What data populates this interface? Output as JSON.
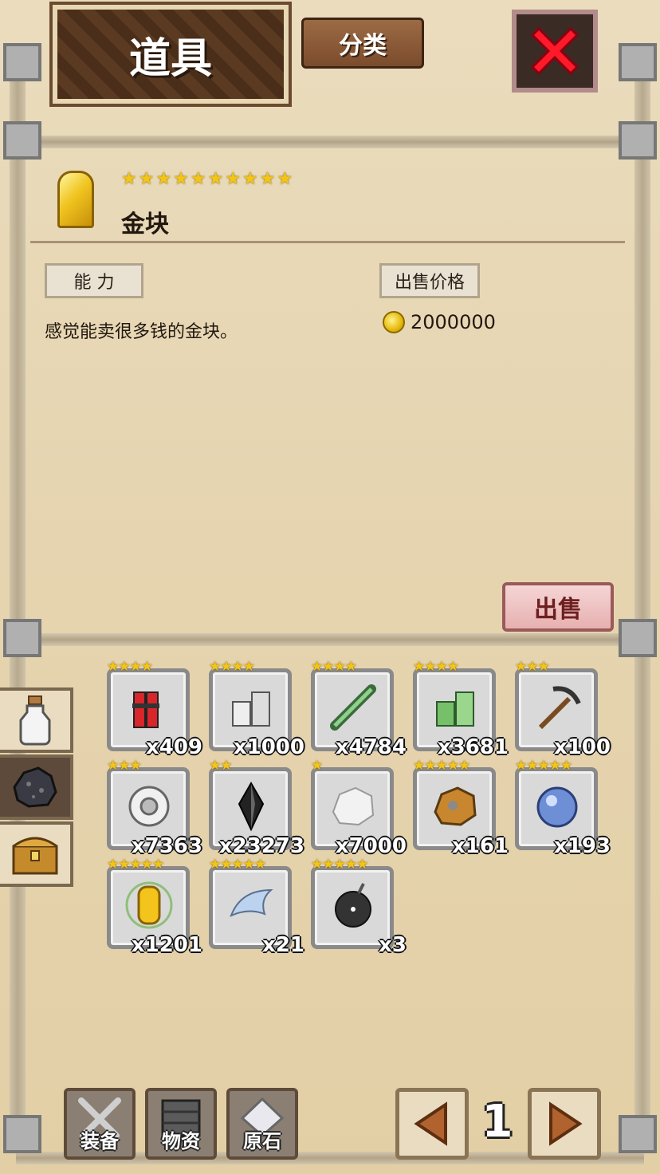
{
  "header": {
    "title": "道具",
    "category_label": "分类"
  },
  "detail": {
    "star_text": "★★★★★★★★★★",
    "star_count": 10,
    "name": "金块",
    "ability_label": "能 力",
    "sell_price_label": "出售价格",
    "description": "感觉能卖很多钱的金块。",
    "price": "2000000",
    "sell_label": "出售"
  },
  "side_tabs": [
    {
      "icon": "bottle-icon",
      "active": false
    },
    {
      "icon": "ore-icon",
      "active": true
    },
    {
      "icon": "chest-icon",
      "active": false
    }
  ],
  "items": [
    {
      "icon": "dynamite-icon",
      "stars": "★★★★",
      "count": "x409"
    },
    {
      "icon": "silver-ingots-icon",
      "stars": "★★★★",
      "count": "x1000"
    },
    {
      "icon": "scroll-icon",
      "stars": "★★★★",
      "count": "x4784"
    },
    {
      "icon": "green-ingots-icon",
      "stars": "★★★★",
      "count": "x3681"
    },
    {
      "icon": "pickaxe-icon",
      "stars": "★★★",
      "count": "x100"
    },
    {
      "icon": "gear-icon",
      "stars": "★★★",
      "count": "x7363"
    },
    {
      "icon": "black-crystal-icon",
      "stars": "★★",
      "count": "x23273"
    },
    {
      "icon": "white-ore-icon",
      "stars": "★",
      "count": "x7000"
    },
    {
      "icon": "copper-ore-icon",
      "stars": "★★★★★",
      "count": "x161"
    },
    {
      "icon": "blue-orb-icon",
      "stars": "★★★★★",
      "count": "x193"
    },
    {
      "icon": "gold-nugget-icon",
      "stars": "★★★★★",
      "count": "x1201"
    },
    {
      "icon": "wing-icon",
      "stars": "★★★★★",
      "count": "x21"
    },
    {
      "icon": "bomb-icon",
      "stars": "★★★★★",
      "count": "x3"
    }
  ],
  "bottom_nav": {
    "equipment_label": "装备",
    "materials_label": "物资",
    "gem_label": "原石",
    "page": "1"
  }
}
